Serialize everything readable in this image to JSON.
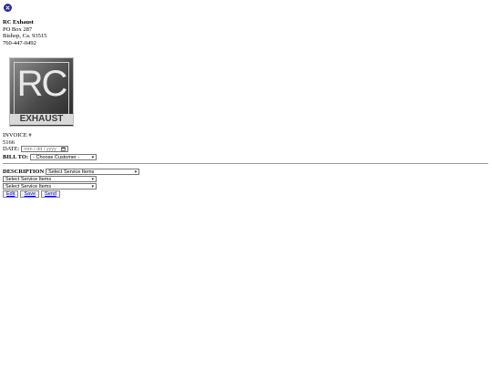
{
  "company": {
    "name": "RC Exhaust",
    "address1": "PO Box 287",
    "address2": "Bishop, Ca. 93515",
    "phone": "760-447-0492"
  },
  "logo": {
    "main": "RC",
    "sub": "EXHAUST"
  },
  "invoice": {
    "label": "INVOICE #",
    "number": "5166",
    "date_label": "DATE:",
    "date_placeholder": "mm / dd / yyyy",
    "bill_to_label": "BILL TO:",
    "customer_selected": "- Choose Customer -"
  },
  "items": {
    "description_label": "DESCRIPTION",
    "select_default": "Select Service Items",
    "rows": [
      "Select Service Items",
      "Select Service Items",
      "Select Service Items"
    ]
  },
  "actions": {
    "edit": "Edit",
    "save": "Save",
    "send": "Send"
  },
  "colors": {
    "close_button": "#2a2a9a",
    "link": "#0000ee"
  },
  "icons": {
    "close": "close-icon",
    "calendar": "calendar-icon",
    "dropdown": "chevron-down-icon"
  }
}
